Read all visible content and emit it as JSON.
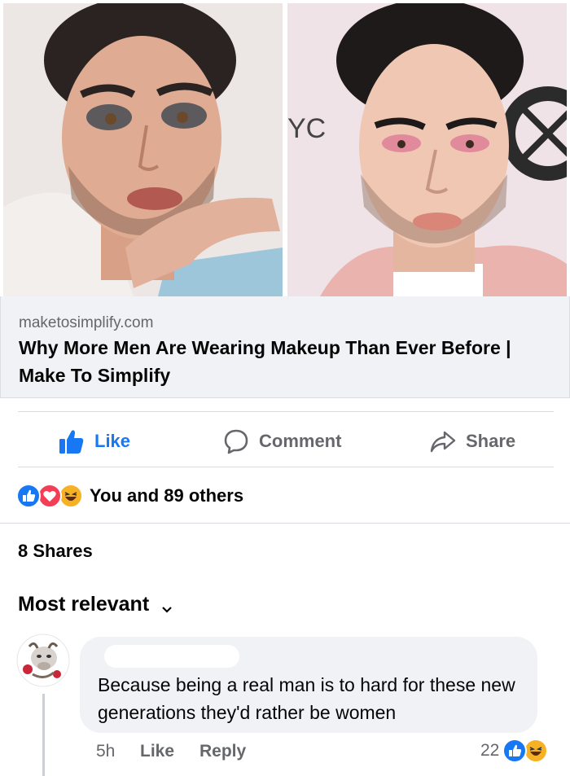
{
  "link_preview": {
    "domain": "maketosimplify.com",
    "title": "Why More Men Are Wearing Makeup Than Ever Before | Make To Simplify",
    "photo_sign_text": "YC"
  },
  "actions": {
    "like_label": "Like",
    "comment_label": "Comment",
    "share_label": "Share"
  },
  "reactions": {
    "icons": [
      "like-reaction-icon",
      "love-reaction-icon",
      "haha-reaction-icon"
    ],
    "summary": "You and 89 others"
  },
  "shares_text": "8 Shares",
  "sort": {
    "label": "Most relevant"
  },
  "comment": {
    "text": "Because being a real man is to hard for these new generations they'd rather be women",
    "time": "5h",
    "like_label": "Like",
    "reply_label": "Reply",
    "reaction_count": "22",
    "reaction_icons": [
      "like-reaction-icon",
      "haha-reaction-icon"
    ]
  },
  "colors": {
    "accent": "#1877f2",
    "secondary_text": "#65676b",
    "love": "#f33e58",
    "haha": "#f7b125",
    "card_bg": "#f0f2f5"
  }
}
